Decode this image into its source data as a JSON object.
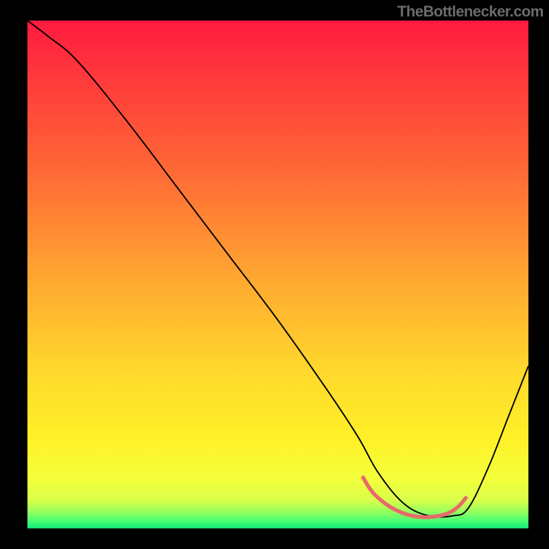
{
  "watermark": "TheBottlenecker.com",
  "chart_data": {
    "type": "line",
    "title": "",
    "xlabel": "",
    "ylabel": "",
    "xlim": [
      0,
      100
    ],
    "ylim": [
      0,
      100
    ],
    "background_gradient_stops": [
      {
        "offset": 0,
        "color": "#ff1a40"
      },
      {
        "offset": 0.12,
        "color": "#ff3b3b"
      },
      {
        "offset": 0.3,
        "color": "#ff6a36"
      },
      {
        "offset": 0.5,
        "color": "#ffa531"
      },
      {
        "offset": 0.68,
        "color": "#ffd62c"
      },
      {
        "offset": 0.82,
        "color": "#fff028"
      },
      {
        "offset": 0.9,
        "color": "#f5ff3a"
      },
      {
        "offset": 0.945,
        "color": "#d8ff4a"
      },
      {
        "offset": 0.965,
        "color": "#9cff5c"
      },
      {
        "offset": 0.985,
        "color": "#4cff74"
      },
      {
        "offset": 1.0,
        "color": "#10e878"
      }
    ],
    "series": [
      {
        "name": "bottleneck-curve",
        "color": "#000000",
        "width": 2,
        "x": [
          0,
          4,
          10,
          20,
          30,
          40,
          50,
          60,
          66,
          70,
          75,
          80,
          85,
          88,
          92,
          96,
          100
        ],
        "y": [
          100,
          97,
          92,
          80,
          67,
          54,
          41,
          27,
          18,
          11,
          5,
          2.5,
          2.5,
          4,
          12,
          22,
          32
        ]
      },
      {
        "name": "optimal-band",
        "color": "#e86a6a",
        "width": 5.5,
        "cap": "round",
        "x": [
          67,
          69,
          72,
          75,
          78,
          81,
          84,
          86,
          87.5
        ],
        "y": [
          10,
          7,
          4.5,
          3,
          2.3,
          2.3,
          3,
          4.3,
          6
        ]
      }
    ],
    "optimal_dots": {
      "color": "#e86a6a",
      "r": 4,
      "points": [
        {
          "x": 67,
          "y": 10
        },
        {
          "x": 69,
          "y": 7
        },
        {
          "x": 71,
          "y": 5
        },
        {
          "x": 73,
          "y": 3.8
        },
        {
          "x": 75,
          "y": 3
        },
        {
          "x": 77,
          "y": 2.5
        },
        {
          "x": 79,
          "y": 2.3
        },
        {
          "x": 81,
          "y": 2.3
        },
        {
          "x": 83,
          "y": 2.7
        },
        {
          "x": 85,
          "y": 3.5
        },
        {
          "x": 87.5,
          "y": 6
        }
      ]
    }
  }
}
